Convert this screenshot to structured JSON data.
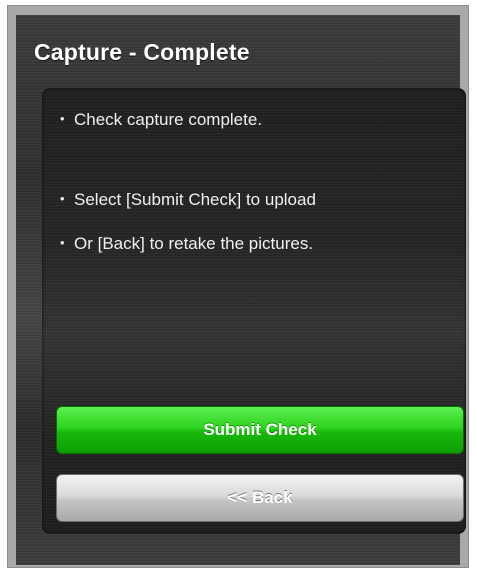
{
  "header": {
    "title": "Capture - Complete"
  },
  "panel": {
    "bullet_glyph": "•",
    "lines": [
      "Check capture complete.",
      "Select [Submit Check] to upload",
      "Or [Back] to retake the pictures."
    ]
  },
  "actions": {
    "submit_label": "Submit Check",
    "back_label": "<< Back"
  },
  "colors": {
    "submit_green": "#2ed31f",
    "back_gray": "#c4c4c4",
    "background_dark": "#333333"
  }
}
